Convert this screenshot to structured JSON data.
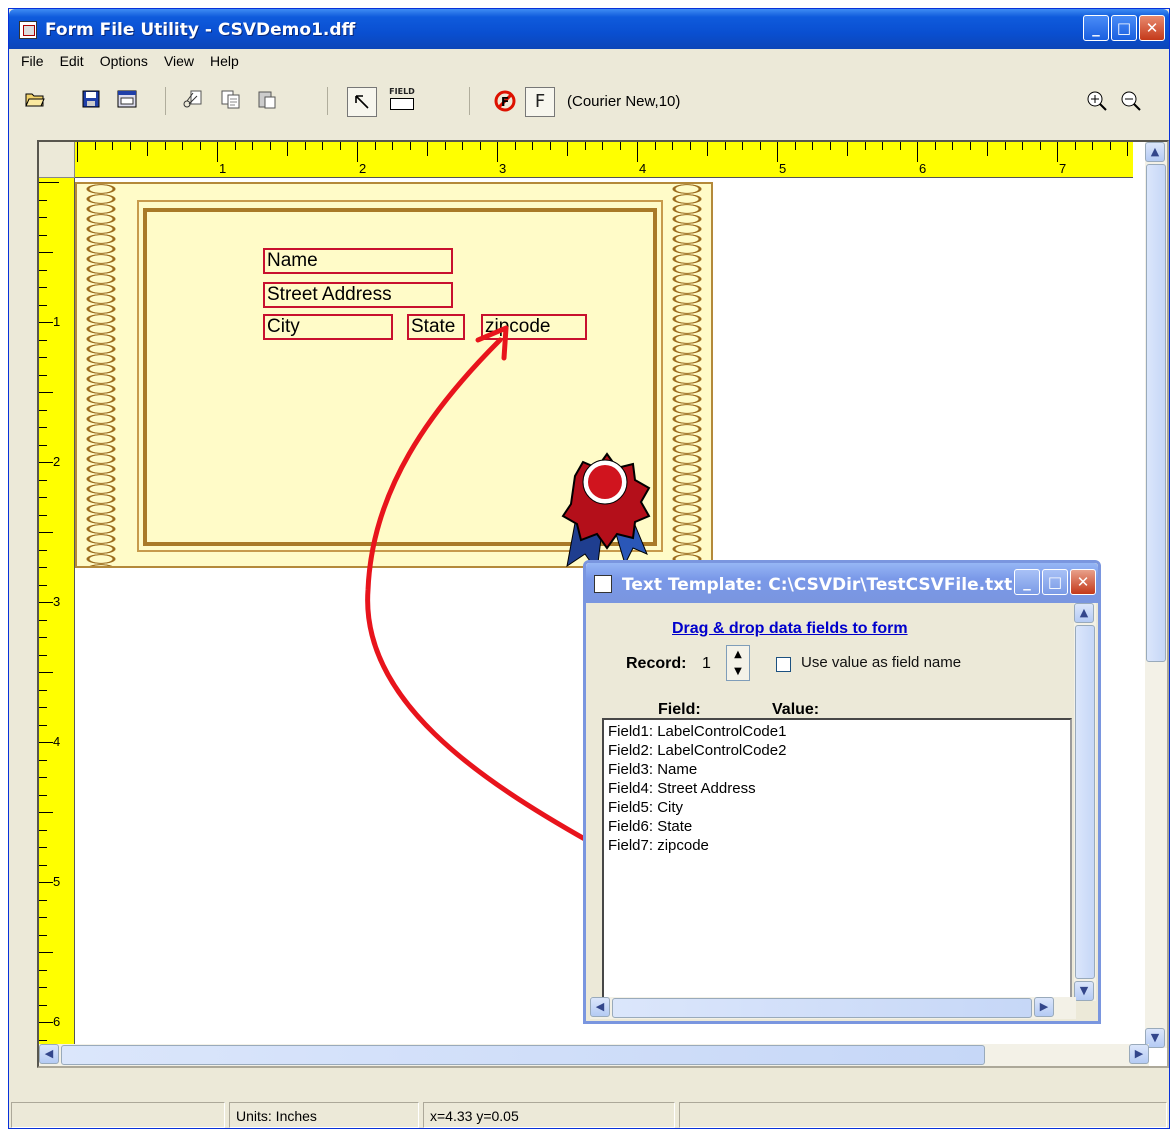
{
  "window": {
    "title": "Form File Utility - CSVDemo1.dff",
    "buttons": {
      "minimize": "_",
      "maximize": "□",
      "close": "✕"
    }
  },
  "menu": [
    "File",
    "Edit",
    "Options",
    "View",
    "Help"
  ],
  "toolbar": {
    "field_label": "FIELD",
    "font_button": "F",
    "font_label": "(Courier New,10)"
  },
  "ruler": {
    "h_labels": [
      "1",
      "2",
      "3",
      "4",
      "5",
      "6",
      "7"
    ],
    "v_labels": [
      "1",
      "2",
      "3",
      "4",
      "5",
      "6"
    ]
  },
  "form_fields": {
    "name": "Name",
    "street": "Street Address",
    "city": "City",
    "state": "State",
    "zipcode": "zipcode"
  },
  "statusbar": {
    "units": "Units: Inches",
    "coords": "x=4.33 y=0.05"
  },
  "subwindow": {
    "title": "Text Template: C:\\CSVDir\\TestCSVFile.txt",
    "drag_link": "Drag & drop data fields to form",
    "record_label": "Record:",
    "record_value": "1",
    "checkbox_label": "Use value as field name",
    "checkbox_checked": false,
    "col_field": "Field:",
    "col_value": "Value:",
    "fields": [
      "Field1: LabelControlCode1",
      "Field2: LabelControlCode2",
      "Field3: Name",
      "Field4: Street Address",
      "Field5: City",
      "Field6: State",
      "Field7:  zipcode"
    ]
  },
  "colors": {
    "ruler": "#ffff00",
    "certificate": "#fffbc8",
    "field_border": "#c8102e",
    "arrow": "#e8141c",
    "link": "#0000cc"
  }
}
